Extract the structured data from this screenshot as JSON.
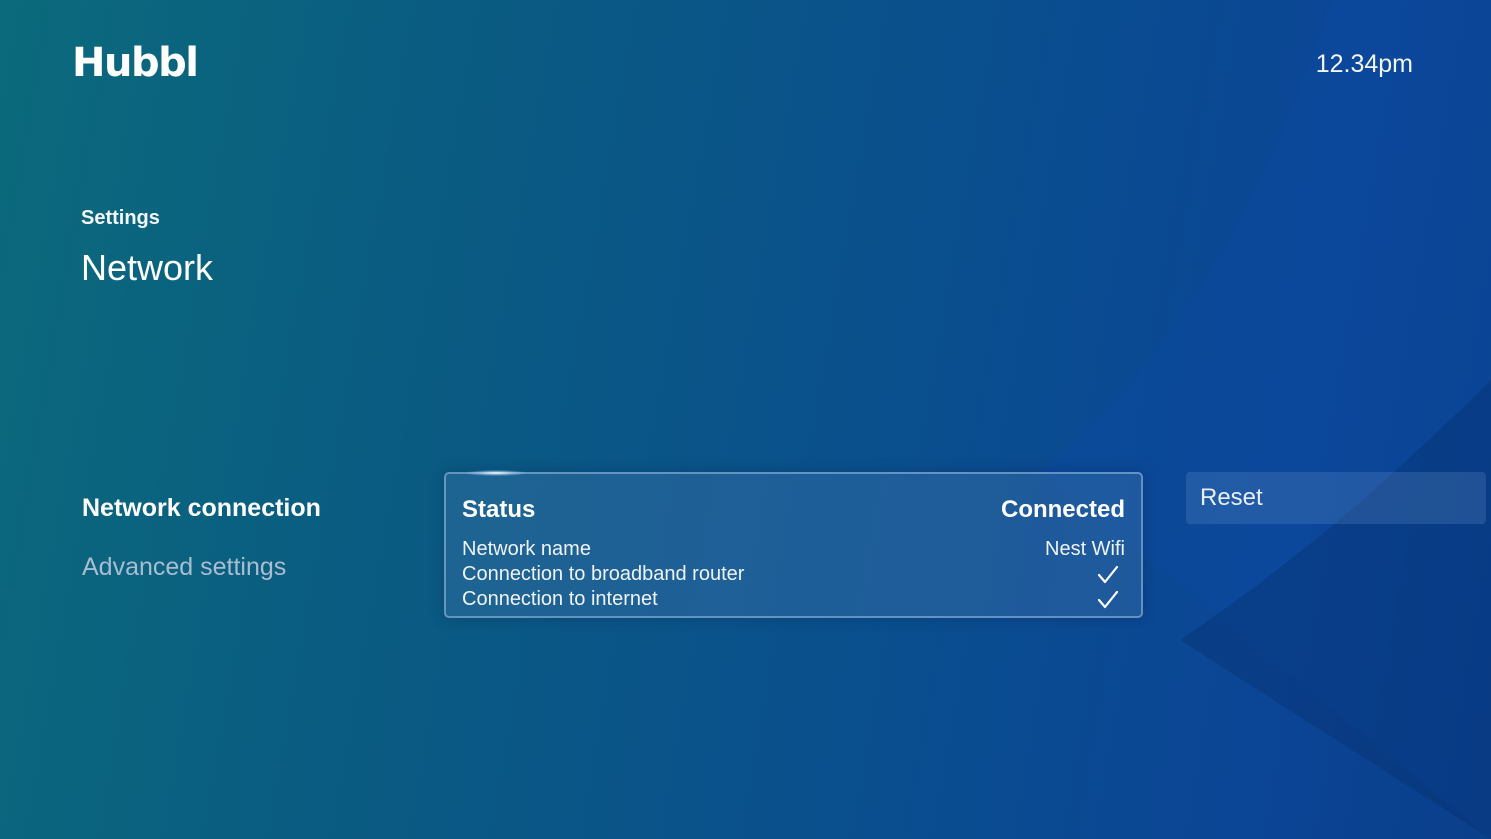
{
  "header": {
    "logo": "Hubbl",
    "time": "12.34pm"
  },
  "page": {
    "breadcrumb": "Settings",
    "title": "Network"
  },
  "nav": {
    "items": [
      {
        "label": "Network connection",
        "state": "selected"
      },
      {
        "label": "Advanced settings",
        "state": "unselected"
      }
    ]
  },
  "status_card": {
    "heading_label": "Status",
    "heading_value": "Connected",
    "rows": [
      {
        "label": "Network name",
        "value": "Nest Wifi"
      },
      {
        "label": "Connection to broadband router",
        "value": "",
        "icon": "checkmark-icon"
      },
      {
        "label": "Connection to internet",
        "value": "",
        "icon": "checkmark-icon"
      }
    ]
  },
  "actions": {
    "reset_label": "Reset"
  },
  "colors": {
    "background_start": "#0b6a7c",
    "background_end": "#0a3f8a",
    "inactive_text": "#a9bdd2",
    "text": "#ffffff"
  }
}
